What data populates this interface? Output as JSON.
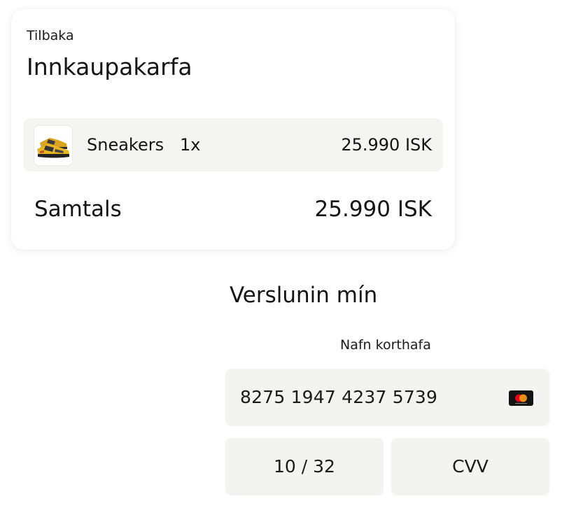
{
  "cart": {
    "back_label": "Tilbaka",
    "title": "Innkaupakarfa",
    "items": [
      {
        "image_icon": "sneaker-product-image",
        "name": "Sneakers",
        "quantity": "1x",
        "price": "25.990 ISK"
      }
    ],
    "total_label": "Samtals",
    "total_value": "25.990 ISK"
  },
  "payment": {
    "shop_title": "Verslunin mín",
    "card_holder_label": "Nafn korthafa",
    "card_number": "8275 1947 4237 5739",
    "card_brand_icon": "mastercard-icon",
    "expiry": "10 / 32",
    "cvv_placeholder": "CVV"
  },
  "colors": {
    "field_background": "#f3f3f1",
    "item_background": "#f4f4f2",
    "text": "#141414",
    "sneaker_yellow": "#e8b524",
    "mastercard_red": "#eb001b",
    "mastercard_orange": "#f79e1b"
  }
}
